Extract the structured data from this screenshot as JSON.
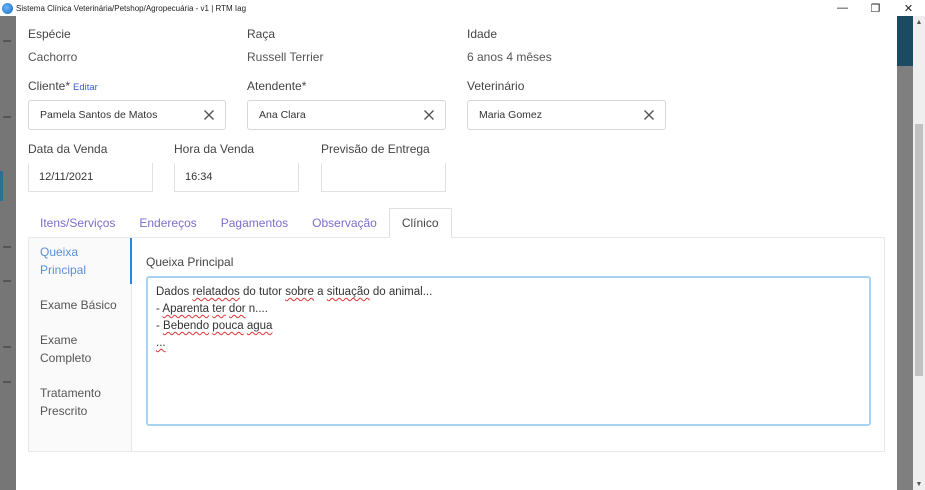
{
  "window": {
    "title": "Sistema Clínica Veterinária/Petshop/Agropecuária - v1 | RTM Iag",
    "minimize": "—",
    "maximize": "❐",
    "close": "✕"
  },
  "animal": {
    "especie_label": "Espécie",
    "especie_value": "Cachorro",
    "raca_label": "Raça",
    "raca_value": "Russell Terrier",
    "idade_label": "Idade",
    "idade_value": "6 anos 4 mêses"
  },
  "people": {
    "cliente_label": "Cliente*",
    "cliente_edit": "Editar",
    "cliente_value": "Pamela Santos de Matos",
    "atendente_label": "Atendente*",
    "atendente_value": "Ana Clara",
    "veterinario_label": "Veterinário",
    "veterinario_value": "Maria Gomez"
  },
  "sale": {
    "data_label": "Data da Venda",
    "data_value": "12/11/2021",
    "hora_label": "Hora da Venda",
    "hora_value": "16:34",
    "previsao_label": "Previsão de Entrega",
    "previsao_value": ""
  },
  "tabs": [
    {
      "label": "Itens/Serviços",
      "active": false
    },
    {
      "label": "Endereços",
      "active": false
    },
    {
      "label": "Pagamentos",
      "active": false
    },
    {
      "label": "Observação",
      "active": false
    },
    {
      "label": "Clínico",
      "active": true
    }
  ],
  "clinical_nav": [
    {
      "label": "Queixa Principal",
      "active": true
    },
    {
      "label": "Exame Básico",
      "active": false
    },
    {
      "label": "Exame Completo",
      "active": false
    },
    {
      "label": "Tratamento Prescrito",
      "active": false
    }
  ],
  "queixa": {
    "title": "Queixa Principal",
    "lines": [
      "Dados relatados do tutor sobre a situação do animal...",
      "- Aparenta ter dor n....",
      "- Bebendo pouca agua",
      "..."
    ]
  },
  "colors": {
    "accent": "#7a6fd0",
    "active_blue": "#2e86d6",
    "focus_border": "#a8d3f0"
  }
}
